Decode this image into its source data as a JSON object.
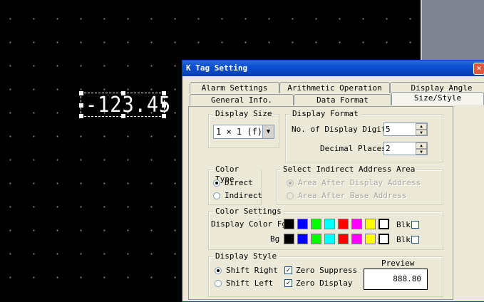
{
  "canvas": {
    "tag_value": "-123.45"
  },
  "dialog": {
    "title": "K Tag Setting",
    "close_glyph": "✕",
    "tabs_row1": [
      "Alarm Settings",
      "Arithmetic Operation",
      "Display Angle"
    ],
    "tabs_row2": [
      "General Info.",
      "Data Format",
      "Size/Style"
    ],
    "active_tab": "Size/Style"
  },
  "display_size": {
    "legend": "Display Size",
    "selected": "1 × 1 (f)"
  },
  "display_format": {
    "legend": "Display Format",
    "digits_label": "No. of Display Digits",
    "digits_value": "5",
    "decimal_label": "Decimal Places",
    "decimal_value": "2"
  },
  "color_type": {
    "legend": "Color Type",
    "options": [
      "Direct",
      "Indirect"
    ],
    "selected": "Direct"
  },
  "indirect_area": {
    "legend": "Select Indirect Address Area",
    "options": [
      "Area After Display Address",
      "Area After Base Address"
    ]
  },
  "color_settings": {
    "legend": "Color Settings",
    "fg_label": "Display Color Fg",
    "bg_label": "Bg",
    "blk_label": "Blk",
    "palette": [
      "#000000",
      "#0000ff",
      "#00ff00",
      "#00ffff",
      "#ff0000",
      "#ff00ff",
      "#ffff00",
      "#ffffff"
    ],
    "fg_selected": "#ffffff",
    "bg_selected": "#ffffff"
  },
  "display_style": {
    "legend": "Display Style",
    "options": [
      "Shift Right",
      "Shift Left"
    ],
    "selected": "Shift Right",
    "checks": [
      "Zero Suppress",
      "Zero Display"
    ],
    "preview_label": "Preview",
    "preview_value": "888.80"
  }
}
